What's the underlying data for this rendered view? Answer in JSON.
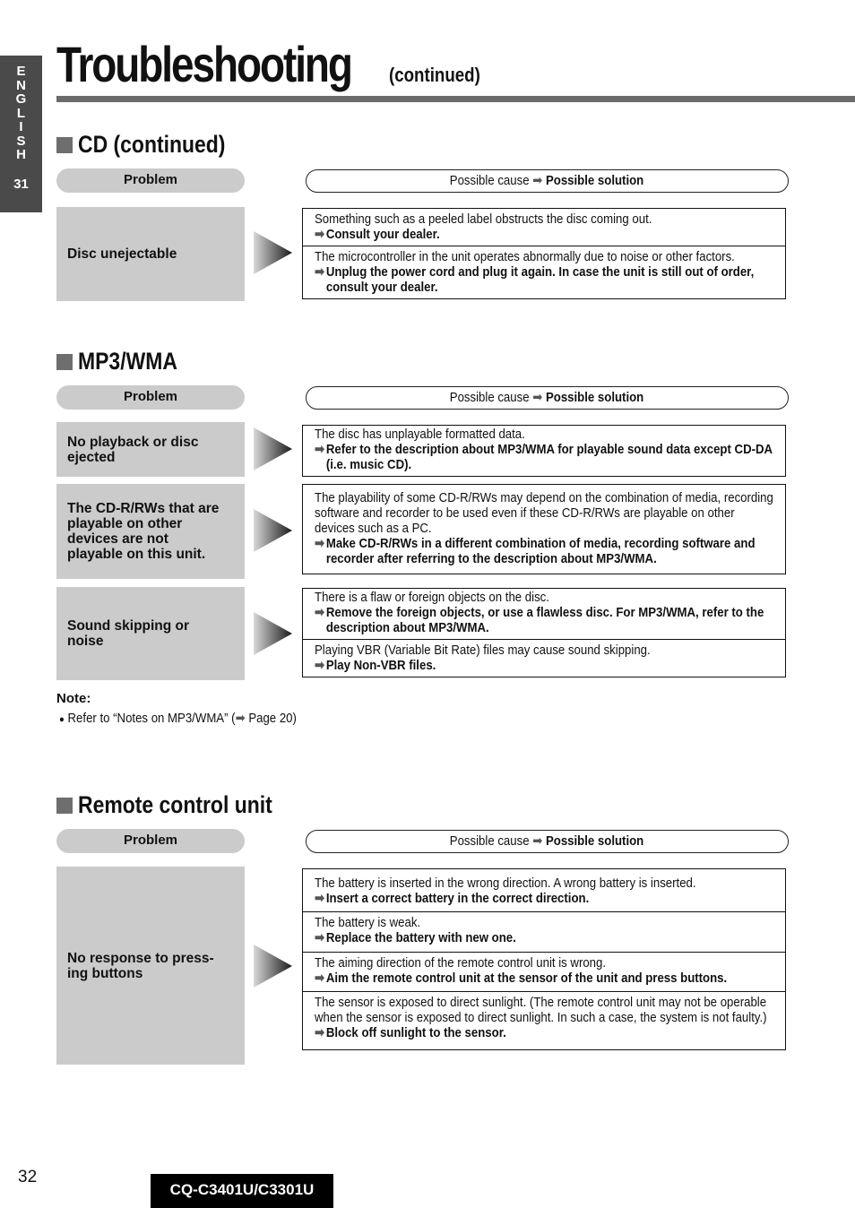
{
  "side_tab": {
    "letters": [
      "E",
      "N",
      "G",
      "L",
      "I",
      "S",
      "H"
    ],
    "page": "31"
  },
  "header": {
    "title": "Troubleshooting",
    "subtitle": "(continued)"
  },
  "legend": {
    "problem_label": "Problem",
    "cause_label": "Possible cause",
    "arrow": "➡",
    "solution_label": "Possible solution"
  },
  "sections": [
    {
      "heading": "CD (continued)",
      "rows": [
        {
          "problem": "Disc unejectable",
          "items": [
            {
              "cause": "Something such as a peeled label obstructs the disc coming out.",
              "solution": "Consult your dealer."
            },
            {
              "cause": "The microcontroller in the unit operates abnormally due to noise or other factors.",
              "solution": "Unplug the power cord and plug it again. In case the unit is still out of order, consult your dealer."
            }
          ]
        }
      ]
    },
    {
      "heading": "MP3/WMA",
      "rows": [
        {
          "problem": "No playback or disc\nejected",
          "items": [
            {
              "cause": "The disc has unplayable formatted data.",
              "solution": "Refer to the description about MP3/WMA for playable sound data except CD-DA (i.e. music CD)."
            }
          ]
        },
        {
          "problem": "The CD-R/RWs that are\nplayable on other\ndevices are not\nplayable on this unit.",
          "items": [
            {
              "cause": "The playability of some CD-R/RWs may depend on the combination of media, recording software and recorder to be used even if these CD-R/RWs are playable on other devices such as a PC.",
              "solution": "Make CD-R/RWs in a different combination of media, recording software and recorder after referring to the description about MP3/WMA."
            }
          ]
        },
        {
          "problem": "Sound skipping or\nnoise",
          "items": [
            {
              "cause": "There is a flaw or foreign objects on the disc.",
              "solution": "Remove the foreign objects, or use a flawless disc. For MP3/WMA, refer to the description about MP3/WMA."
            },
            {
              "cause": "Playing VBR (Variable Bit Rate) files may cause sound skipping.",
              "solution": "Play Non-VBR files."
            }
          ]
        }
      ],
      "note": {
        "heading": "Note:",
        "bullet": "●",
        "text_before": "Refer to “Notes on MP3/WMA” (",
        "text_after": " Page 20)"
      }
    },
    {
      "heading": "Remote control unit",
      "rows": [
        {
          "problem": "No response to press-\ning buttons",
          "items": [
            {
              "cause": "The battery is inserted in the wrong direction. A wrong battery is inserted.",
              "solution": "Insert a correct battery in the correct direction."
            },
            {
              "cause": "The battery is weak.",
              "solution": "Replace the battery with new one."
            },
            {
              "cause": "The aiming direction of the remote control unit is wrong.",
              "solution": "Aim the remote control unit at the sensor of the unit and press buttons."
            },
            {
              "cause": "The sensor is exposed to direct sunlight. (The remote control unit may not be operable when the sensor is exposed to direct sunlight. In such a case, the system is not faulty.)",
              "solution": "Block off sunlight to the sensor."
            }
          ]
        }
      ]
    }
  ],
  "footer": {
    "page_number": "32",
    "model": "CQ-C3401U/C3301U"
  }
}
